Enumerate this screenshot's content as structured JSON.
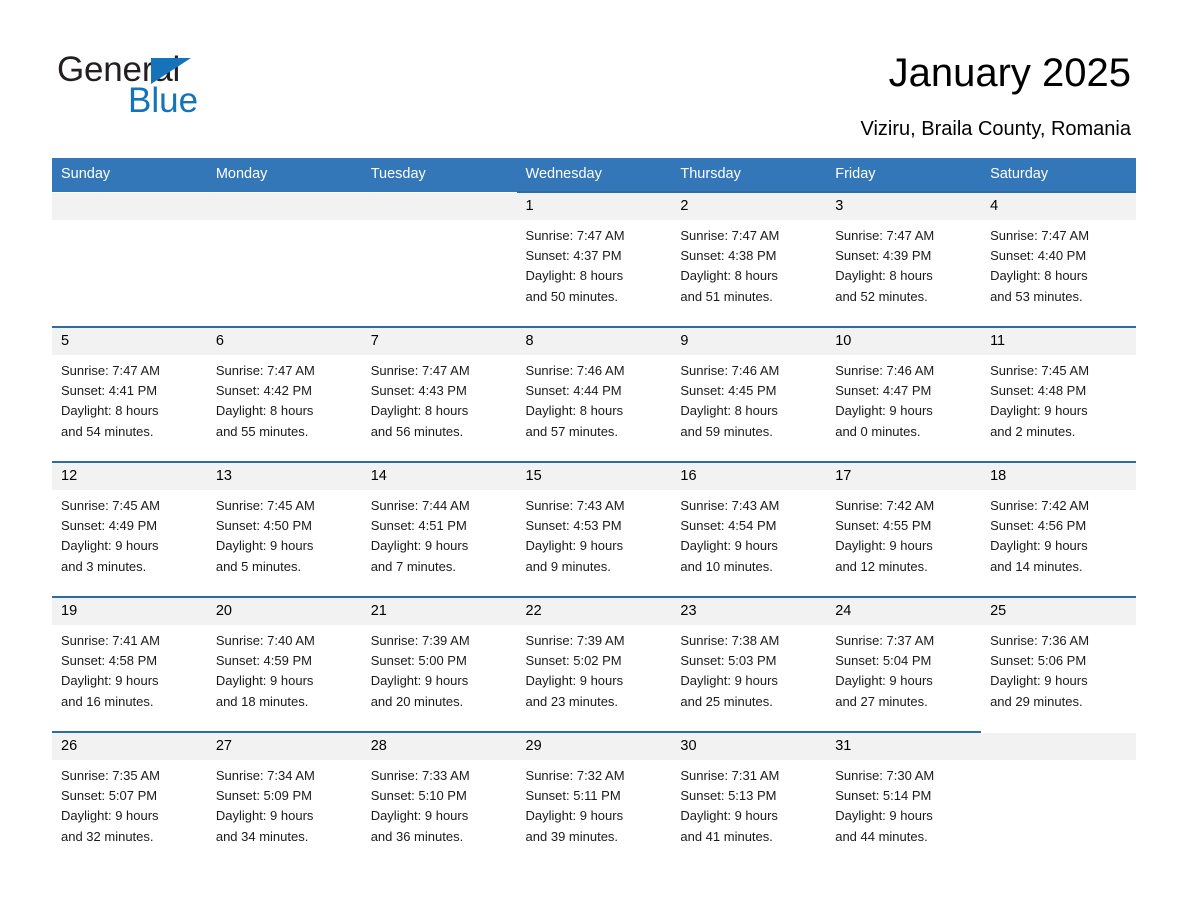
{
  "brand": {
    "name_part1": "General",
    "name_part2": "Blue",
    "accent_color": "#1573ba"
  },
  "header": {
    "title": "January 2025",
    "subtitle": "Viziru, Braila County, Romania"
  },
  "calendar": {
    "header_bg": "#3377b8",
    "row_rule_color": "#2e6da4",
    "daynum_band_bg": "#f2f2f2",
    "weekday_headers": [
      "Sunday",
      "Monday",
      "Tuesday",
      "Wednesday",
      "Thursday",
      "Friday",
      "Saturday"
    ],
    "weeks": [
      [
        {
          "day": "",
          "sunrise": "",
          "sunset": "",
          "daylight_line1": "",
          "daylight_line2": ""
        },
        {
          "day": "",
          "sunrise": "",
          "sunset": "",
          "daylight_line1": "",
          "daylight_line2": ""
        },
        {
          "day": "",
          "sunrise": "",
          "sunset": "",
          "daylight_line1": "",
          "daylight_line2": ""
        },
        {
          "day": "1",
          "sunrise": "Sunrise: 7:47 AM",
          "sunset": "Sunset: 4:37 PM",
          "daylight_line1": "Daylight: 8 hours",
          "daylight_line2": "and 50 minutes."
        },
        {
          "day": "2",
          "sunrise": "Sunrise: 7:47 AM",
          "sunset": "Sunset: 4:38 PM",
          "daylight_line1": "Daylight: 8 hours",
          "daylight_line2": "and 51 minutes."
        },
        {
          "day": "3",
          "sunrise": "Sunrise: 7:47 AM",
          "sunset": "Sunset: 4:39 PM",
          "daylight_line1": "Daylight: 8 hours",
          "daylight_line2": "and 52 minutes."
        },
        {
          "day": "4",
          "sunrise": "Sunrise: 7:47 AM",
          "sunset": "Sunset: 4:40 PM",
          "daylight_line1": "Daylight: 8 hours",
          "daylight_line2": "and 53 minutes."
        }
      ],
      [
        {
          "day": "5",
          "sunrise": "Sunrise: 7:47 AM",
          "sunset": "Sunset: 4:41 PM",
          "daylight_line1": "Daylight: 8 hours",
          "daylight_line2": "and 54 minutes."
        },
        {
          "day": "6",
          "sunrise": "Sunrise: 7:47 AM",
          "sunset": "Sunset: 4:42 PM",
          "daylight_line1": "Daylight: 8 hours",
          "daylight_line2": "and 55 minutes."
        },
        {
          "day": "7",
          "sunrise": "Sunrise: 7:47 AM",
          "sunset": "Sunset: 4:43 PM",
          "daylight_line1": "Daylight: 8 hours",
          "daylight_line2": "and 56 minutes."
        },
        {
          "day": "8",
          "sunrise": "Sunrise: 7:46 AM",
          "sunset": "Sunset: 4:44 PM",
          "daylight_line1": "Daylight: 8 hours",
          "daylight_line2": "and 57 minutes."
        },
        {
          "day": "9",
          "sunrise": "Sunrise: 7:46 AM",
          "sunset": "Sunset: 4:45 PM",
          "daylight_line1": "Daylight: 8 hours",
          "daylight_line2": "and 59 minutes."
        },
        {
          "day": "10",
          "sunrise": "Sunrise: 7:46 AM",
          "sunset": "Sunset: 4:47 PM",
          "daylight_line1": "Daylight: 9 hours",
          "daylight_line2": "and 0 minutes."
        },
        {
          "day": "11",
          "sunrise": "Sunrise: 7:45 AM",
          "sunset": "Sunset: 4:48 PM",
          "daylight_line1": "Daylight: 9 hours",
          "daylight_line2": "and 2 minutes."
        }
      ],
      [
        {
          "day": "12",
          "sunrise": "Sunrise: 7:45 AM",
          "sunset": "Sunset: 4:49 PM",
          "daylight_line1": "Daylight: 9 hours",
          "daylight_line2": "and 3 minutes."
        },
        {
          "day": "13",
          "sunrise": "Sunrise: 7:45 AM",
          "sunset": "Sunset: 4:50 PM",
          "daylight_line1": "Daylight: 9 hours",
          "daylight_line2": "and 5 minutes."
        },
        {
          "day": "14",
          "sunrise": "Sunrise: 7:44 AM",
          "sunset": "Sunset: 4:51 PM",
          "daylight_line1": "Daylight: 9 hours",
          "daylight_line2": "and 7 minutes."
        },
        {
          "day": "15",
          "sunrise": "Sunrise: 7:43 AM",
          "sunset": "Sunset: 4:53 PM",
          "daylight_line1": "Daylight: 9 hours",
          "daylight_line2": "and 9 minutes."
        },
        {
          "day": "16",
          "sunrise": "Sunrise: 7:43 AM",
          "sunset": "Sunset: 4:54 PM",
          "daylight_line1": "Daylight: 9 hours",
          "daylight_line2": "and 10 minutes."
        },
        {
          "day": "17",
          "sunrise": "Sunrise: 7:42 AM",
          "sunset": "Sunset: 4:55 PM",
          "daylight_line1": "Daylight: 9 hours",
          "daylight_line2": "and 12 minutes."
        },
        {
          "day": "18",
          "sunrise": "Sunrise: 7:42 AM",
          "sunset": "Sunset: 4:56 PM",
          "daylight_line1": "Daylight: 9 hours",
          "daylight_line2": "and 14 minutes."
        }
      ],
      [
        {
          "day": "19",
          "sunrise": "Sunrise: 7:41 AM",
          "sunset": "Sunset: 4:58 PM",
          "daylight_line1": "Daylight: 9 hours",
          "daylight_line2": "and 16 minutes."
        },
        {
          "day": "20",
          "sunrise": "Sunrise: 7:40 AM",
          "sunset": "Sunset: 4:59 PM",
          "daylight_line1": "Daylight: 9 hours",
          "daylight_line2": "and 18 minutes."
        },
        {
          "day": "21",
          "sunrise": "Sunrise: 7:39 AM",
          "sunset": "Sunset: 5:00 PM",
          "daylight_line1": "Daylight: 9 hours",
          "daylight_line2": "and 20 minutes."
        },
        {
          "day": "22",
          "sunrise": "Sunrise: 7:39 AM",
          "sunset": "Sunset: 5:02 PM",
          "daylight_line1": "Daylight: 9 hours",
          "daylight_line2": "and 23 minutes."
        },
        {
          "day": "23",
          "sunrise": "Sunrise: 7:38 AM",
          "sunset": "Sunset: 5:03 PM",
          "daylight_line1": "Daylight: 9 hours",
          "daylight_line2": "and 25 minutes."
        },
        {
          "day": "24",
          "sunrise": "Sunrise: 7:37 AM",
          "sunset": "Sunset: 5:04 PM",
          "daylight_line1": "Daylight: 9 hours",
          "daylight_line2": "and 27 minutes."
        },
        {
          "day": "25",
          "sunrise": "Sunrise: 7:36 AM",
          "sunset": "Sunset: 5:06 PM",
          "daylight_line1": "Daylight: 9 hours",
          "daylight_line2": "and 29 minutes."
        }
      ],
      [
        {
          "day": "26",
          "sunrise": "Sunrise: 7:35 AM",
          "sunset": "Sunset: 5:07 PM",
          "daylight_line1": "Daylight: 9 hours",
          "daylight_line2": "and 32 minutes."
        },
        {
          "day": "27",
          "sunrise": "Sunrise: 7:34 AM",
          "sunset": "Sunset: 5:09 PM",
          "daylight_line1": "Daylight: 9 hours",
          "daylight_line2": "and 34 minutes."
        },
        {
          "day": "28",
          "sunrise": "Sunrise: 7:33 AM",
          "sunset": "Sunset: 5:10 PM",
          "daylight_line1": "Daylight: 9 hours",
          "daylight_line2": "and 36 minutes."
        },
        {
          "day": "29",
          "sunrise": "Sunrise: 7:32 AM",
          "sunset": "Sunset: 5:11 PM",
          "daylight_line1": "Daylight: 9 hours",
          "daylight_line2": "and 39 minutes."
        },
        {
          "day": "30",
          "sunrise": "Sunrise: 7:31 AM",
          "sunset": "Sunset: 5:13 PM",
          "daylight_line1": "Daylight: 9 hours",
          "daylight_line2": "and 41 minutes."
        },
        {
          "day": "31",
          "sunrise": "Sunrise: 7:30 AM",
          "sunset": "Sunset: 5:14 PM",
          "daylight_line1": "Daylight: 9 hours",
          "daylight_line2": "and 44 minutes."
        },
        {
          "day": "",
          "sunrise": "",
          "sunset": "",
          "daylight_line1": "",
          "daylight_line2": ""
        }
      ]
    ]
  }
}
